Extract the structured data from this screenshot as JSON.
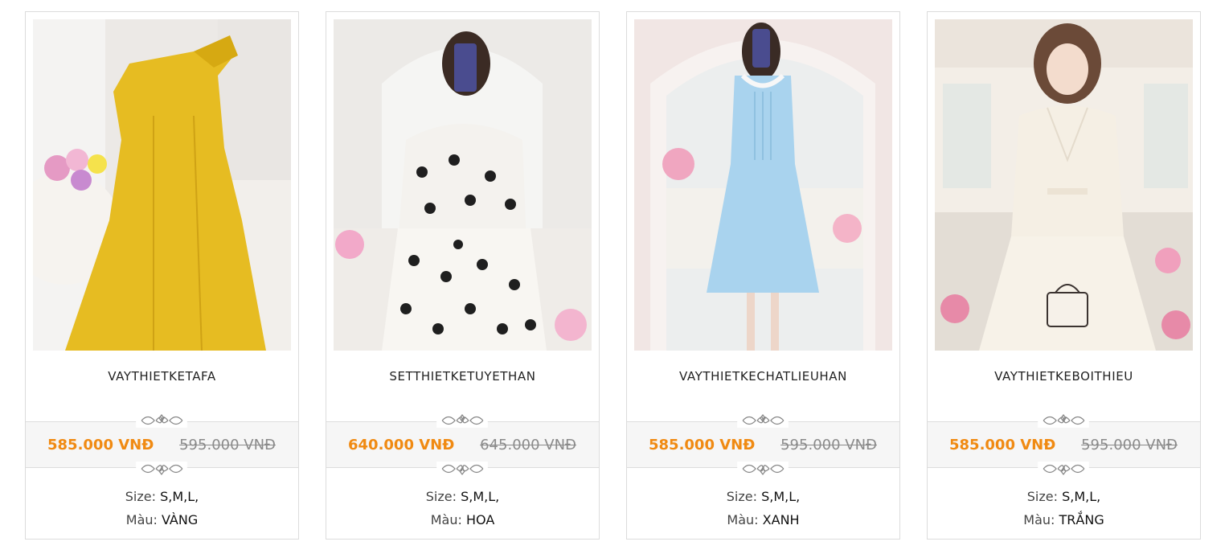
{
  "products": [
    {
      "name": "VAYTHIETKETAFA",
      "price": "585.000 VNĐ",
      "old_price": "595.000 VNĐ",
      "size_label": "Size:",
      "size_value": "S,M,L,",
      "color_label": "Màu:",
      "color_value": "VÀNG",
      "image_alt": "yellow-dress-photo",
      "dress_color": "#e6bc22"
    },
    {
      "name": "SETTHIETKETUYETHAN",
      "price": "640.000 VNĐ",
      "old_price": "645.000 VNĐ",
      "size_label": "Size:",
      "size_value": "S,M,L,",
      "color_label": "Màu:",
      "color_value": "HOA",
      "image_alt": "floral-set-photo",
      "dress_color": "#f4f2ee"
    },
    {
      "name": "VAYTHIETKECHATLIEUHAN",
      "price": "585.000 VNĐ",
      "old_price": "595.000 VNĐ",
      "size_label": "Size:",
      "size_value": "S,M,L,",
      "color_label": "Màu:",
      "color_value": "XANH",
      "image_alt": "blue-dress-photo",
      "dress_color": "#a9d3ee"
    },
    {
      "name": "VAYTHIETKEBOITHIEU",
      "price": "585.000 VNĐ",
      "old_price": "595.000 VNĐ",
      "size_label": "Size:",
      "size_value": "S,M,L,",
      "color_label": "Màu:",
      "color_value": "TRẮNG",
      "image_alt": "white-dress-photo",
      "dress_color": "#f5efe4"
    }
  ],
  "colors": {
    "price": "#f08a12",
    "old_price": "#8a8a8a",
    "border": "#dcdcdc",
    "band": "#f6f6f6"
  }
}
